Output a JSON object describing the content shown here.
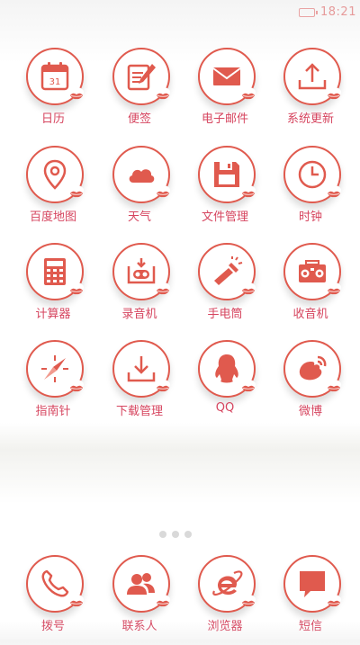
{
  "status_bar": {
    "time": "18:21"
  },
  "grid_apps": [
    {
      "label": "日历",
      "icon": "calendar-icon",
      "badge": "31"
    },
    {
      "label": "便签",
      "icon": "notes-icon"
    },
    {
      "label": "电子邮件",
      "icon": "mail-icon"
    },
    {
      "label": "系统更新",
      "icon": "upload-icon"
    },
    {
      "label": "百度地图",
      "icon": "map-pin-icon"
    },
    {
      "label": "天气",
      "icon": "cloud-icon"
    },
    {
      "label": "文件管理",
      "icon": "floppy-icon"
    },
    {
      "label": "时钟",
      "icon": "clock-icon"
    },
    {
      "label": "计算器",
      "icon": "calculator-icon"
    },
    {
      "label": "录音机",
      "icon": "recorder-icon"
    },
    {
      "label": "手电筒",
      "icon": "flashlight-icon"
    },
    {
      "label": "收音机",
      "icon": "radio-icon"
    },
    {
      "label": "指南针",
      "icon": "compass-icon"
    },
    {
      "label": "下载管理",
      "icon": "download-icon"
    },
    {
      "label": "QQ",
      "icon": "penguin-icon"
    },
    {
      "label": "微博",
      "icon": "weibo-icon"
    }
  ],
  "dock_apps": [
    {
      "label": "拨号",
      "icon": "phone-icon"
    },
    {
      "label": "联系人",
      "icon": "contacts-icon"
    },
    {
      "label": "浏览器",
      "icon": "browser-icon"
    },
    {
      "label": "短信",
      "icon": "message-icon"
    }
  ],
  "colors": {
    "accent": "#e05a4e",
    "label": "#d6455f"
  }
}
